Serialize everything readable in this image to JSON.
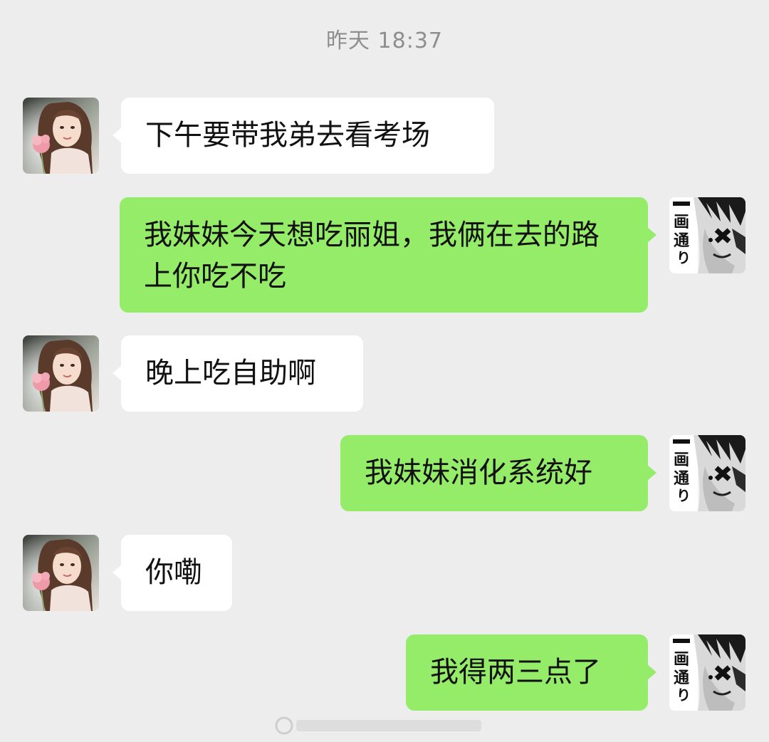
{
  "timestamp": "昨天 18:37",
  "contact": {
    "avatar": "contact-avatar-girl-with-flower"
  },
  "self": {
    "avatar": "self-avatar-manga-character"
  },
  "messages": [
    {
      "sender": "contact",
      "text": "下午要带我弟去看考场"
    },
    {
      "sender": "self",
      "text": "我妹妹今天想吃丽姐，我俩在去的路上你吃不吃"
    },
    {
      "sender": "contact",
      "text": "晚上吃自助啊"
    },
    {
      "sender": "self",
      "text": "我妹妹消化系统好"
    },
    {
      "sender": "contact",
      "text": "你嘞"
    },
    {
      "sender": "self",
      "text": "我得两三点了"
    }
  ],
  "colors": {
    "background": "#ededed",
    "incoming_bubble": "#ffffff",
    "outgoing_bubble": "#95ec69",
    "timestamp": "#8e8e8e"
  }
}
